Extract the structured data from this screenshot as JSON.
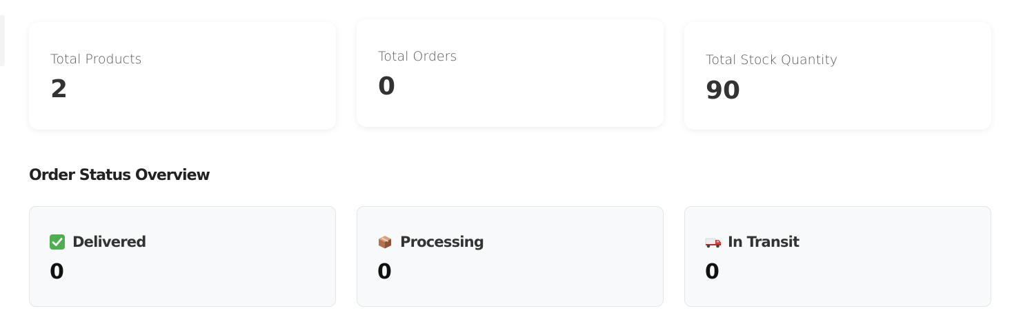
{
  "stats": {
    "products": {
      "label": "Total Products",
      "value": "2"
    },
    "orders": {
      "label": "Total Orders",
      "value": "0"
    },
    "stock": {
      "label": "Total Stock Quantity",
      "value": "90"
    }
  },
  "order_status": {
    "title": "Order Status Overview",
    "items": [
      {
        "label": "Delivered",
        "value": "0",
        "icon": "check-mark-icon",
        "icon_color": "#4caf50"
      },
      {
        "label": "Processing",
        "value": "0",
        "icon": "package-icon",
        "icon_color": "#b87555"
      },
      {
        "label": "In Transit",
        "value": "0",
        "icon": "delivery-truck-icon",
        "icon_color": "#e53935"
      }
    ]
  },
  "colors": {
    "card_background": "#ffffff",
    "status_card_background": "#f8f9fa",
    "text_primary": "#333333",
    "text_secondary": "#555555"
  }
}
